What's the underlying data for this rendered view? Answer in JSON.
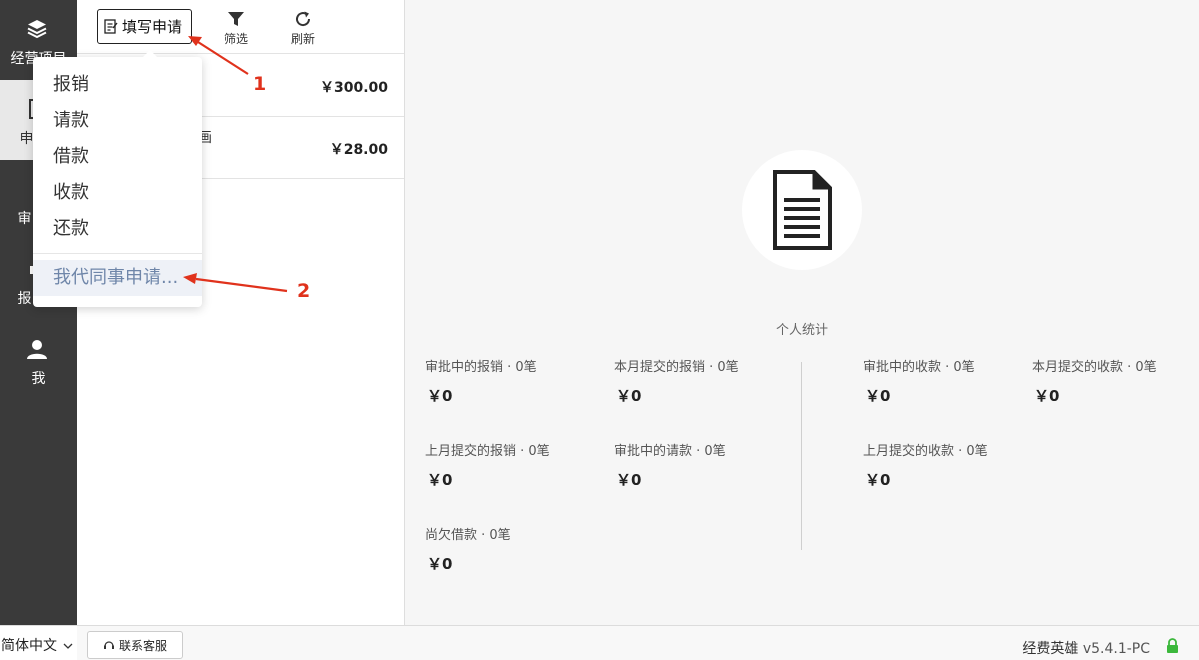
{
  "nav": {
    "items": [
      {
        "label": "经营项目",
        "icon": "layers-icon"
      },
      {
        "label": "申",
        "icon": "document-icon"
      },
      {
        "label": "审",
        "icon": "approval-icon"
      },
      {
        "label": "报",
        "icon": "report-icon"
      },
      {
        "label": "我",
        "icon": "user-icon"
      }
    ]
  },
  "toolbar": {
    "fill_label": "填写申请",
    "filter_label": "筛选",
    "refresh_label": "刷新"
  },
  "list": {
    "rows": [
      {
        "title": "",
        "amount": "￥300.00"
      },
      {
        "title": "画",
        "amount": "￥28.00"
      }
    ]
  },
  "dropdown": {
    "items": [
      "报销",
      "请款",
      "借款",
      "收款",
      "还款"
    ],
    "colleague": "我代同事申请..."
  },
  "annotations": {
    "one": "1",
    "two": "2"
  },
  "stats": {
    "title": "个人统计",
    "items": [
      {
        "label": "审批中的报销 · 0笔",
        "value": "￥0"
      },
      {
        "label": "本月提交的报销 · 0笔",
        "value": "￥0"
      },
      {
        "label": "上月提交的报销 · 0笔",
        "value": "￥0"
      },
      {
        "label": "审批中的请款 · 0笔",
        "value": "￥0"
      },
      {
        "label": "尚欠借款 · 0笔",
        "value": "￥0"
      },
      {
        "label": "审批中的收款 · 0笔",
        "value": "￥0"
      },
      {
        "label": "本月提交的收款 · 0笔",
        "value": "￥0"
      },
      {
        "label": "上月提交的收款 · 0笔",
        "value": "￥0"
      }
    ]
  },
  "footer": {
    "language": "简体中文",
    "service": "联系客服",
    "brand": "经费英雄",
    "version": "v5.4.1-PC"
  },
  "colors": {
    "nav_bg": "#3a3a3a",
    "annotation": "#e0321c",
    "highlight": "#6f86a9",
    "lock": "#3cb83c"
  }
}
